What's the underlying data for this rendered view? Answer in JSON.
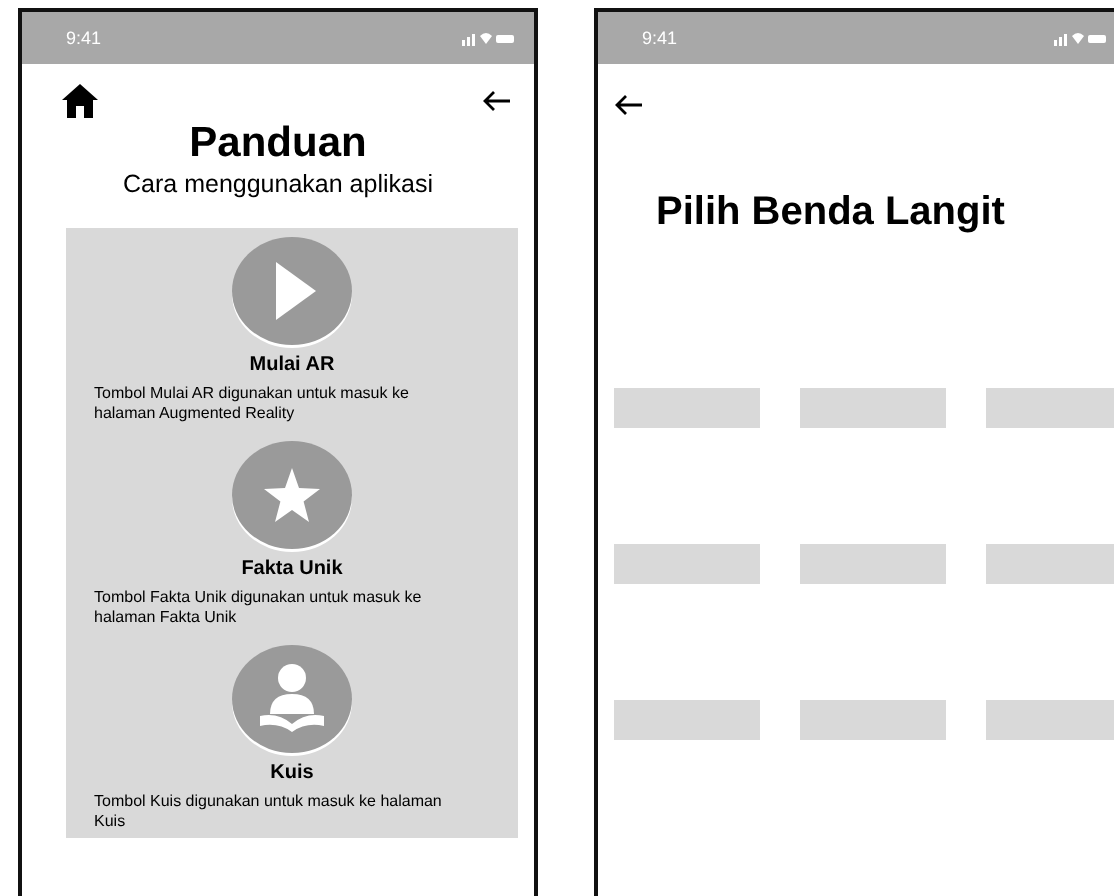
{
  "screens": [
    {
      "status_bar": {
        "time": "9:41"
      },
      "nav": [
        {
          "kind": "home"
        },
        {
          "kind": "back"
        }
      ],
      "title": "Panduan",
      "subtitle": "Cara menggunakan aplikasi",
      "guide": [
        {
          "kind": "play",
          "label": "Mulai AR",
          "description": "Tombol Mulai AR digunakan untuk masuk ke halaman Augmented Reality"
        },
        {
          "kind": "star",
          "label": "Fakta Unik",
          "description": "Tombol Fakta Unik digunakan untuk masuk ke halaman Fakta Unik"
        },
        {
          "kind": "reader",
          "label": "Kuis",
          "description": "Tombol Kuis digunakan untuk masuk ke halaman Kuis"
        }
      ]
    },
    {
      "status_bar": {
        "time": "9:41"
      },
      "nav": [
        {
          "kind": "back"
        }
      ],
      "title": "Pilih Benda Langit",
      "tiles": [
        {
          "kind": "placeholder"
        },
        {
          "kind": "placeholder"
        },
        {
          "kind": "placeholder"
        },
        {
          "kind": "placeholder"
        },
        {
          "kind": "placeholder"
        },
        {
          "kind": "placeholder"
        },
        {
          "kind": "placeholder"
        },
        {
          "kind": "placeholder"
        },
        {
          "kind": "placeholder"
        }
      ]
    }
  ]
}
